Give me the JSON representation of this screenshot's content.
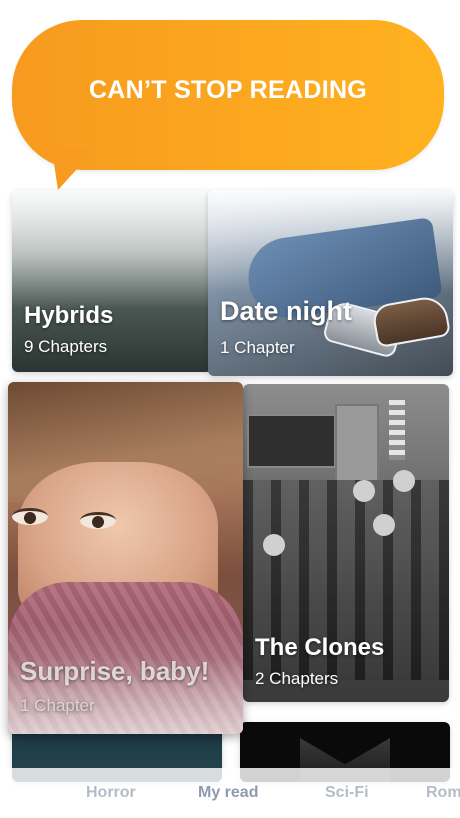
{
  "banner": {
    "text": "CAN’T STOP READING"
  },
  "stories": [
    {
      "title": "Hybrids",
      "chapters": "9 Chapters"
    },
    {
      "title": "Date night",
      "chapters": "1 Chapter"
    },
    {
      "title": "Surprise, baby!",
      "chapters": "1 Chapter"
    },
    {
      "title": "The Clones",
      "chapters": "2 Chapters"
    }
  ],
  "tabs": [
    {
      "label": "Horror"
    },
    {
      "label": "My read",
      "active": true
    },
    {
      "label": "Sci-Fi"
    },
    {
      "label": "Rom"
    }
  ],
  "colors": {
    "banner_start": "#f79a1f",
    "banner_end": "#ffb21f",
    "tab_inactive": "#b6bcc6",
    "tab_active": "#8f9aae"
  }
}
